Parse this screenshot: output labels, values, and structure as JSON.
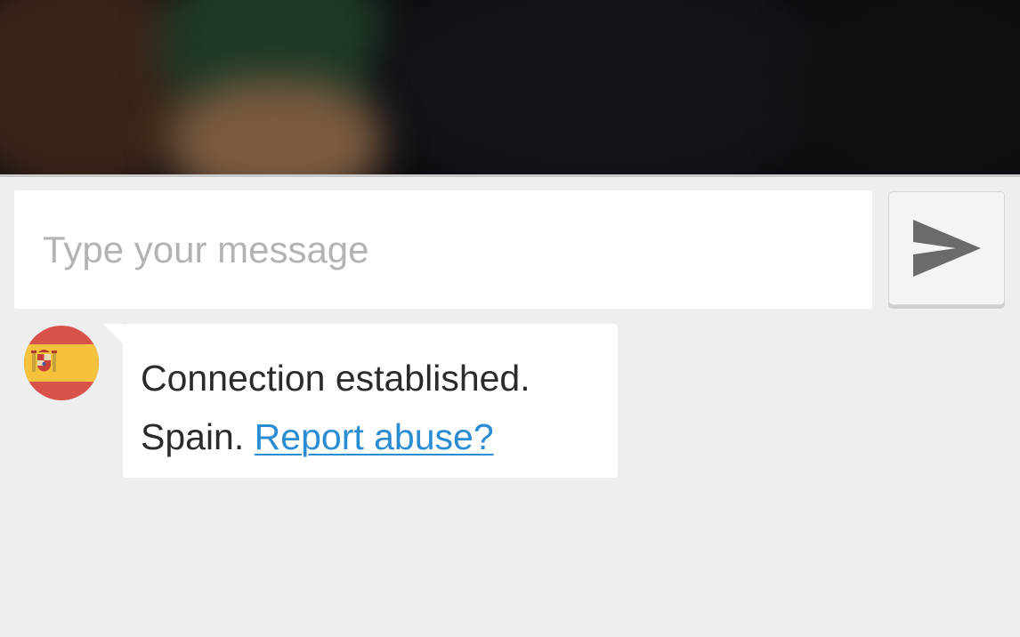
{
  "composer": {
    "placeholder": "Type your message",
    "value": "",
    "send_icon": "send-arrow-icon"
  },
  "messages": [
    {
      "type": "system",
      "avatar_icon": "spain-flag-icon",
      "status_text": "Connection established.",
      "country_text": "Spain.",
      "link_text": "Report abuse?"
    }
  ],
  "colors": {
    "background": "#eeeeee",
    "link": "#2a8dd4",
    "send_icon": "#6b6b6b",
    "flag_red": "#d9534a",
    "flag_yellow": "#f6c23c"
  }
}
